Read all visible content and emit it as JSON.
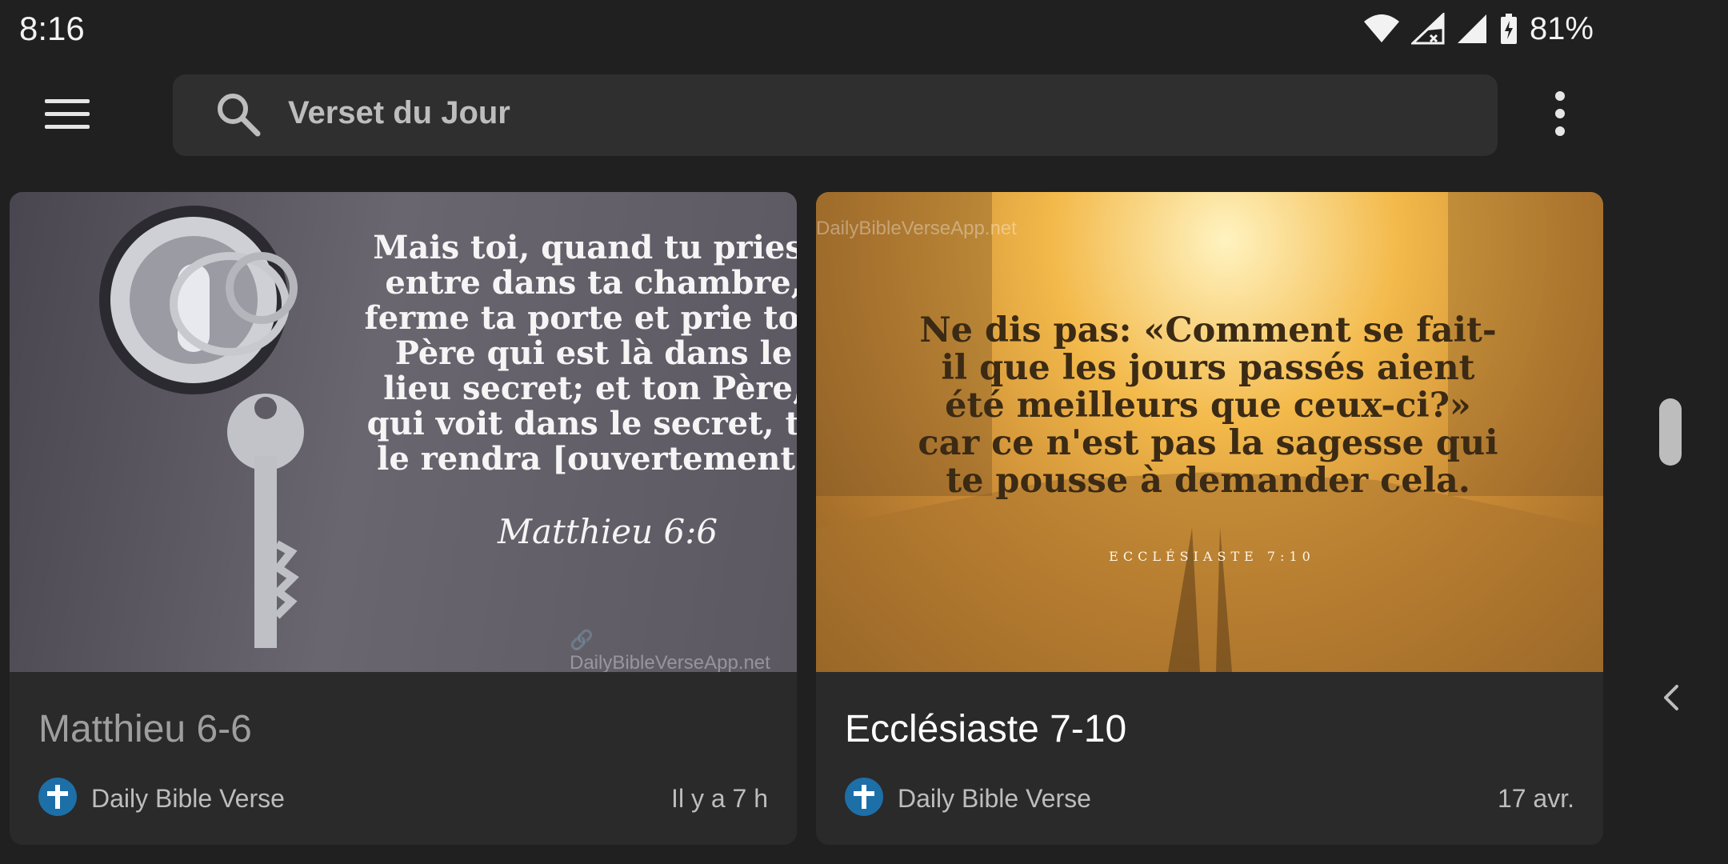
{
  "status_bar": {
    "time": "8:16",
    "battery_percent": "81%",
    "icons": [
      "wifi-icon",
      "signal-x-icon",
      "signal-icon",
      "battery-charging-icon"
    ]
  },
  "toolbar": {
    "menu_icon": "hamburger-menu-icon",
    "search_placeholder": "Verset du Jour",
    "overflow_icon": "more-vert-icon"
  },
  "cards": [
    {
      "image_text": "Mais toi, quand tu pries,\nentre dans ta chambre,\nferme ta porte et prie ton\nPère qui est là dans le\nlieu secret; et ton Père,\nqui voit dans le secret, te\nle rendra [ouvertement]",
      "image_reference": "Matthieu 6:6",
      "watermark": "DailyBibleVerseApp.net",
      "title": "Matthieu 6-6",
      "source": "Daily Bible Verse",
      "date": "Il y a 7 h"
    },
    {
      "image_text": "Ne dis pas: «Comment se fait-\nil que les jours passés aient\nété meilleurs que ceux-ci?»\ncar ce n'est pas la sagesse qui\nte pousse à demander cela.",
      "image_reference": "ECCLÉSIASTE 7:10",
      "watermark": "DailyBibleVerseApp.net",
      "title": "Ecclésiaste 7-10",
      "source": "Daily Bible Verse",
      "date": "17 avr."
    }
  ],
  "colors": {
    "background": "#202020",
    "card": "#2a2a2a",
    "search_bar": "#2f2f2f",
    "source_icon": "#1d6fa8"
  }
}
